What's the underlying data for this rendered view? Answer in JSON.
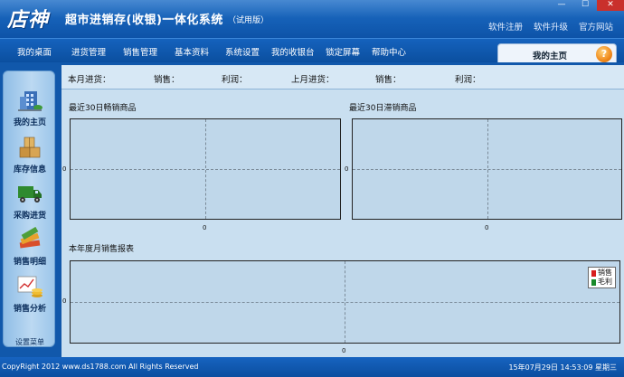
{
  "header": {
    "logo": "店神",
    "title": "超市进销存(收银)一体化系统",
    "edition": "（试用版）",
    "links": [
      "软件注册",
      "软件升级",
      "官方网站"
    ],
    "window_controls": [
      "—",
      "☐",
      "✕"
    ]
  },
  "menu": {
    "items": [
      "我的桌面",
      "进货管理",
      "销售管理",
      "基本资料",
      "系统设置",
      "我的收银台",
      "锁定屏幕",
      "帮助中心"
    ],
    "active_tab": "我的主页",
    "help_badge": "?"
  },
  "sidebar": {
    "items": [
      {
        "label": "我的主页",
        "icon": "building-icon"
      },
      {
        "label": "库存信息",
        "icon": "boxes-icon"
      },
      {
        "label": "采购进货",
        "icon": "truck-icon"
      },
      {
        "label": "销售明细",
        "icon": "books-icon"
      },
      {
        "label": "销售分析",
        "icon": "chart-coins-icon"
      }
    ],
    "settings_label": "设置菜单"
  },
  "stats": {
    "month_purchase": "本月进货：",
    "month_sales": "销售：",
    "month_profit": "利润：",
    "last_month_purchase": "上月进货：",
    "last_month_sales": "销售：",
    "last_month_profit": "利润："
  },
  "sections": {
    "best_sellers": "最近30日畅销商品",
    "slow_sellers": "最近30日滞销商品",
    "monthly_report": "本年度月销售报表"
  },
  "chart_data": [
    {
      "type": "bar",
      "title": "最近30日畅销商品",
      "x_tick": "0",
      "y_tick": "0",
      "grid": true,
      "values": []
    },
    {
      "type": "bar",
      "title": "最近30日滞销商品",
      "x_tick": "0",
      "y_tick": "0",
      "grid": true,
      "values": []
    },
    {
      "type": "bar",
      "title": "本年度月销售报表",
      "x_tick": "0",
      "y_tick": "0",
      "grid": true,
      "legend_position": "top-right",
      "series": [
        {
          "name": "销售",
          "color": "#d81e1e",
          "values": []
        },
        {
          "name": "毛利",
          "color": "#1a8a2a",
          "values": []
        }
      ]
    }
  ],
  "footer": {
    "copyright": "CopyRight 2012   www.ds1788.com   All Rights Reserved",
    "clock": "15年07月29日   14:53:09  星期三"
  }
}
